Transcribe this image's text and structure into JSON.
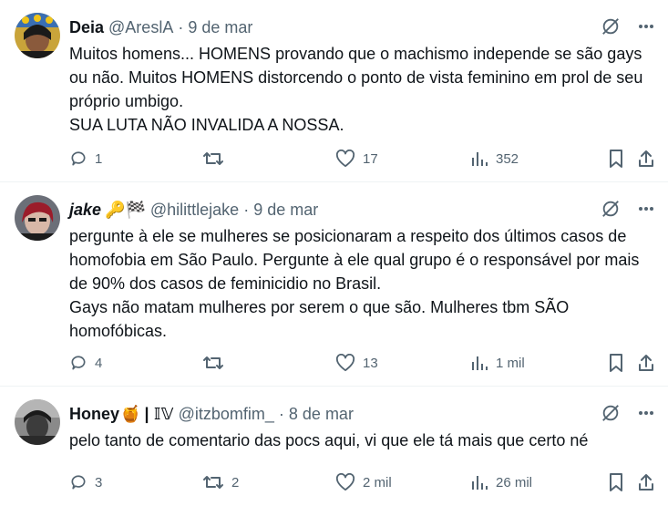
{
  "tweets": [
    {
      "name": "Deia",
      "handle": "@AreslA",
      "date": "9 de mar",
      "text": "Muitos homens... HOMENS provando que o machismo independe se são gays ou não. Muitos HOMENS distorcendo o ponto de vista feminino em prol de seu próprio umbigo.\nSUA LUTA NÃO INVALIDA A NOSSA.",
      "replies": "1",
      "retweets": "",
      "likes": "17",
      "views": "352"
    },
    {
      "name": "jake",
      "name_emoji": "🔑🏁",
      "handle": "@hilittlejake",
      "date": "9 de mar",
      "text": "pergunte à ele se mulheres se posicionaram a respeito dos últimos casos de homofobia em São Paulo. Pergunte à ele qual grupo é o responsável por mais de 90% dos casos de feminicidio no Brasil.\nGays não matam mulheres por serem o que são. Mulheres tbm SÃO homofóbicas.",
      "replies": "4",
      "retweets": "",
      "likes": "13",
      "views": "1 mil"
    },
    {
      "name": "Honey",
      "name_emoji": "🍯",
      "name_suffix": "| 𝕀𝕍",
      "handle": "@itzbomfim_",
      "date": "8 de mar",
      "text": "pelo tanto de comentario das pocs aqui, vi que ele tá mais que certo né",
      "replies": "3",
      "retweets": "2",
      "likes": "2 mil",
      "views": "26 mil"
    }
  ],
  "icons": [
    "grok-icon",
    "more-icon",
    "reply-icon",
    "retweet-icon",
    "like-icon",
    "views-icon",
    "bookmark-icon",
    "share-icon"
  ],
  "colors": {
    "text": "#0f1419",
    "secondary": "#536471",
    "divider": "#eff3f4"
  }
}
